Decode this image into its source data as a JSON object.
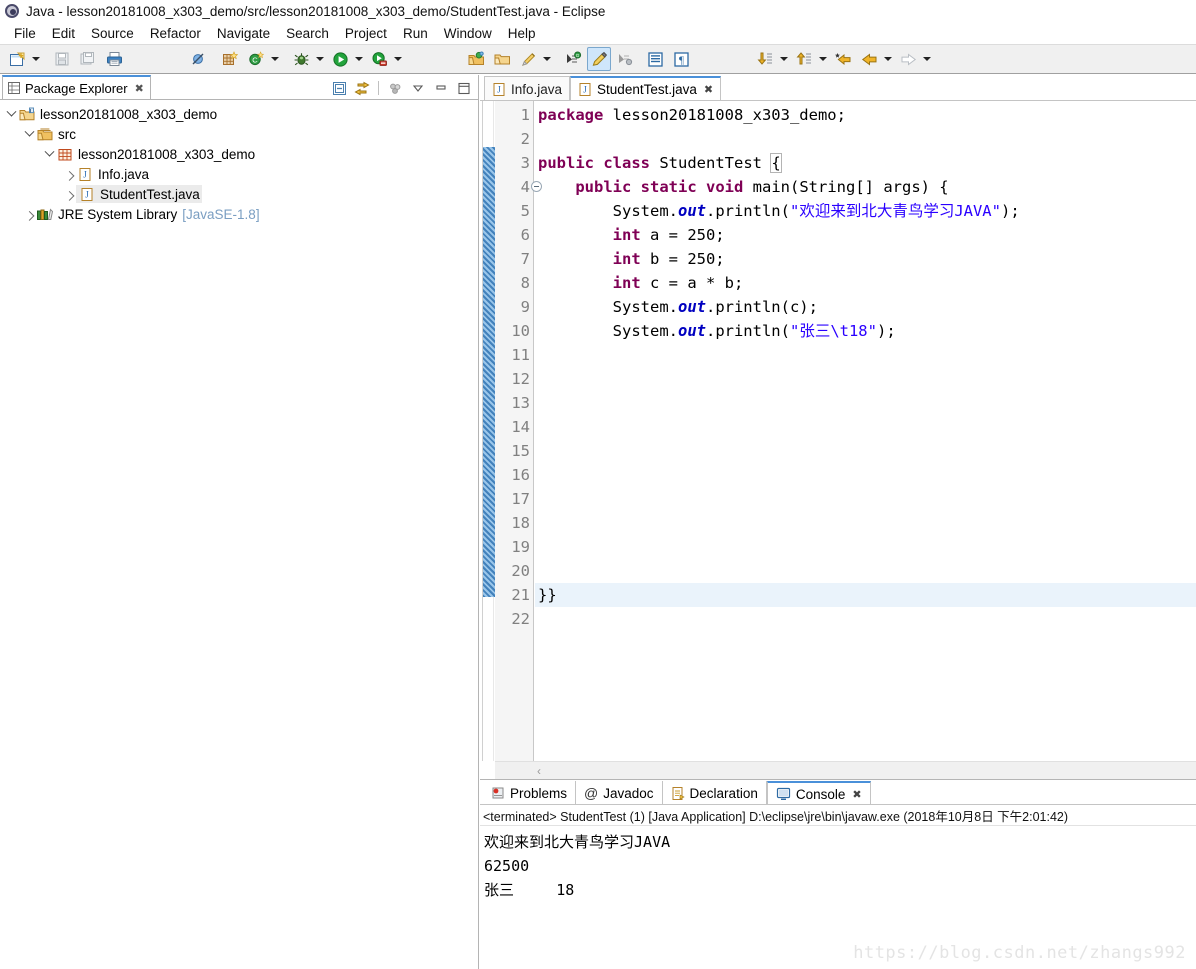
{
  "window": {
    "title": "Java - lesson20181008_x303_demo/src/lesson20181008_x303_demo/StudentTest.java - Eclipse",
    "app_icon": "eclipse-icon"
  },
  "menubar": {
    "items": [
      {
        "label": "File"
      },
      {
        "label": "Edit"
      },
      {
        "label": "Source"
      },
      {
        "label": "Refactor"
      },
      {
        "label": "Navigate"
      },
      {
        "label": "Search"
      },
      {
        "label": "Project"
      },
      {
        "label": "Run"
      },
      {
        "label": "Window"
      },
      {
        "label": "Help"
      }
    ]
  },
  "toolbar": {
    "buttons": [
      {
        "name": "new-wizard",
        "icon": "new-file-icon",
        "dropdown": true
      },
      {
        "name": "save",
        "icon": "save-icon",
        "dropdown": false
      },
      {
        "name": "save-all",
        "icon": "save-all-icon",
        "dropdown": false
      },
      {
        "name": "print",
        "icon": "print-icon",
        "dropdown": false
      },
      {
        "name": "skip-all-breakpoints",
        "icon": "skip-breakpoints-icon",
        "dropdown": false
      },
      {
        "name": "new-java-package",
        "icon": "new-package-icon",
        "dropdown": false
      },
      {
        "name": "new-java-class",
        "icon": "new-class-icon",
        "dropdown": true
      },
      {
        "name": "debug",
        "icon": "debug-bug-icon",
        "dropdown": true
      },
      {
        "name": "run",
        "icon": "run-play-icon",
        "dropdown": true
      },
      {
        "name": "run-external-tools",
        "icon": "external-tools-icon",
        "dropdown": true
      },
      {
        "name": "new-java-project",
        "icon": "java-project-icon",
        "dropdown": false
      },
      {
        "name": "open-type",
        "icon": "open-folder-icon",
        "dropdown": false
      },
      {
        "name": "search",
        "icon": "search-pencil-icon",
        "dropdown": true
      },
      {
        "name": "next-annotation",
        "icon": "next-annotation-icon",
        "dropdown": false
      },
      {
        "name": "toggle-mark-occurrences",
        "icon": "marker-highlight-icon",
        "dropdown": false,
        "selected": true
      },
      {
        "name": "previous-annotation",
        "icon": "prev-annotation-icon",
        "dropdown": false
      },
      {
        "name": "toggle-block-selection",
        "icon": "block-selection-icon",
        "dropdown": false
      },
      {
        "name": "show-whitespace",
        "icon": "pilcrow-icon",
        "dropdown": false
      },
      {
        "name": "next-edit-location",
        "icon": "down-arrow-doc-icon",
        "dropdown": true
      },
      {
        "name": "previous-edit-location",
        "icon": "up-arrow-doc-icon",
        "dropdown": true
      },
      {
        "name": "last-edit-location",
        "icon": "star-back-arrow-icon",
        "dropdown": false
      },
      {
        "name": "back",
        "icon": "back-arrow-icon",
        "dropdown": true
      },
      {
        "name": "forward",
        "icon": "forward-arrow-icon",
        "dropdown": true
      }
    ]
  },
  "explorer": {
    "tab": {
      "label": "Package Explorer",
      "icon": "package-explorer-icon",
      "close": "✖"
    },
    "actions": [
      {
        "name": "collapse-all",
        "icon": "collapse-all-icon"
      },
      {
        "name": "link-with-editor",
        "icon": "link-editor-icon"
      },
      {
        "name": "view-menu",
        "icon": "view-menu-icon"
      },
      {
        "name": "minimize",
        "icon": "minimize-icon"
      },
      {
        "name": "maximize",
        "icon": "maximize-icon"
      }
    ],
    "tree": [
      {
        "label": "lesson20181008_x303_demo",
        "icon": "java-project-folder-icon",
        "depth": 0,
        "expanded": true,
        "selected": false,
        "sub": ""
      },
      {
        "label": "src",
        "icon": "source-folder-icon",
        "depth": 1,
        "expanded": true,
        "selected": false,
        "sub": ""
      },
      {
        "label": "lesson20181008_x303_demo",
        "icon": "package-icon",
        "depth": 2,
        "expanded": true,
        "selected": false,
        "sub": ""
      },
      {
        "label": "Info.java",
        "icon": "java-file-icon",
        "depth": 3,
        "expanded": false,
        "selected": false,
        "sub": ""
      },
      {
        "label": "StudentTest.java",
        "icon": "java-file-icon",
        "depth": 3,
        "expanded": false,
        "selected": true,
        "sub": ""
      },
      {
        "label": "JRE System Library",
        "icon": "jre-library-icon",
        "depth": 1,
        "expanded": false,
        "selected": false,
        "sub": "[JavaSE-1.8]"
      }
    ]
  },
  "editor": {
    "tabs": [
      {
        "label": "Info.java",
        "icon": "java-file-icon",
        "active": false,
        "close": ""
      },
      {
        "label": "StudentTest.java",
        "icon": "java-file-icon",
        "active": true,
        "close": "✖"
      }
    ],
    "first_line": 1,
    "last_line": 22,
    "cursor_line": 21,
    "folding_marker_line": 4,
    "lines": [
      {
        "n": 1,
        "html": "<span class=\"kw\">package</span> lesson20181008_x303_demo;"
      },
      {
        "n": 2,
        "html": ""
      },
      {
        "n": 3,
        "html": "<span class=\"kw\">public</span> <span class=\"kw\">class</span> StudentTest <span class=\"brkt-box\">{</span>"
      },
      {
        "n": 4,
        "html": "    <span class=\"kw\">public</span> <span class=\"kw\">static</span> <span class=\"kw\">void</span> main(String[] args) {"
      },
      {
        "n": 5,
        "html": "        System.<span class=\"fld\">out</span>.println(<span class=\"str\">\"欢迎来到北大青鸟学习JAVA\"</span>);"
      },
      {
        "n": 6,
        "html": "        <span class=\"kw\">int</span> a = 250;"
      },
      {
        "n": 7,
        "html": "        <span class=\"kw\">int</span> b = 250;"
      },
      {
        "n": 8,
        "html": "        <span class=\"kw\">int</span> c = a * b;"
      },
      {
        "n": 9,
        "html": "        System.<span class=\"fld\">out</span>.println(c);"
      },
      {
        "n": 10,
        "html": "        System.<span class=\"fld\">out</span>.println(<span class=\"str\">\"张三\\t18\"</span>);"
      },
      {
        "n": 11,
        "html": ""
      },
      {
        "n": 12,
        "html": ""
      },
      {
        "n": 13,
        "html": ""
      },
      {
        "n": 14,
        "html": ""
      },
      {
        "n": 15,
        "html": ""
      },
      {
        "n": 16,
        "html": ""
      },
      {
        "n": 17,
        "html": ""
      },
      {
        "n": 18,
        "html": ""
      },
      {
        "n": 19,
        "html": ""
      },
      {
        "n": 20,
        "html": ""
      },
      {
        "n": 21,
        "html": "}}"
      },
      {
        "n": 22,
        "html": ""
      }
    ]
  },
  "bottom_panel": {
    "tabs": [
      {
        "label": "Problems",
        "icon": "problems-icon",
        "active": false,
        "close": ""
      },
      {
        "label": "Javadoc",
        "icon": "javadoc-at-icon",
        "active": false,
        "close": ""
      },
      {
        "label": "Declaration",
        "icon": "declaration-icon",
        "active": false,
        "close": ""
      },
      {
        "label": "Console",
        "icon": "console-icon",
        "active": true,
        "close": "✖"
      }
    ],
    "console_header": "<terminated> StudentTest (1) [Java Application] D:\\eclipse\\jre\\bin\\javaw.exe (2018年10月8日 下午2:01:42)",
    "console_output": "欢迎来到北大青鸟学习JAVA\n62500\n张三\t18"
  },
  "watermark": {
    "text": "https://blog.csdn.net/zhangs992"
  },
  "colors": {
    "keyword": "#7f0055",
    "string": "#2a00ff",
    "field": "#0000c0",
    "tab_accent": "#4a90d9",
    "gutter_bg": "#f5f5f5",
    "toolbar_bg": "#f0f0f0",
    "current_line": "#eaf3fb",
    "annotation_ruler": "#2e74b5",
    "sub_label": "#7a9ec2"
  }
}
